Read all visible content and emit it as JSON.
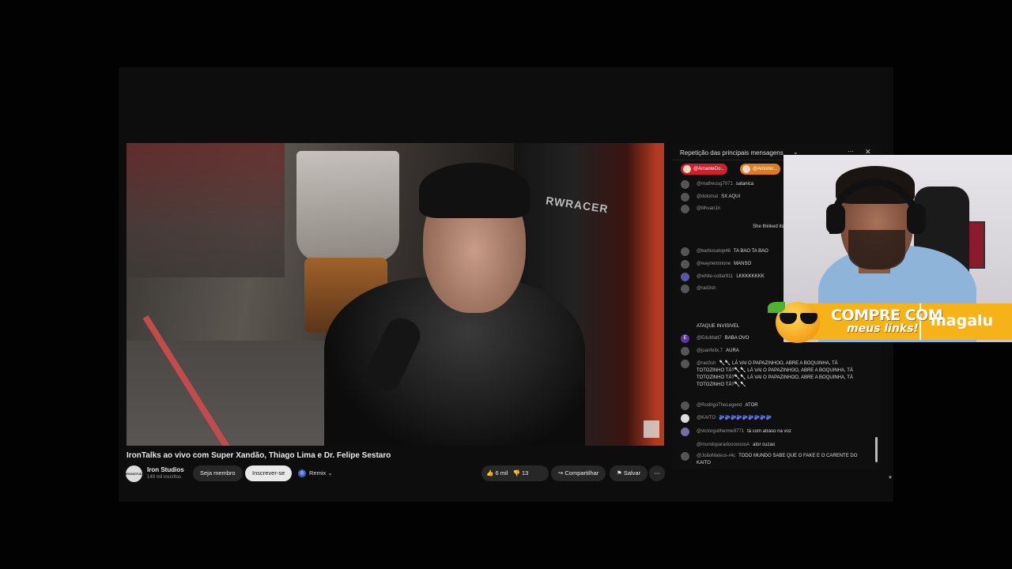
{
  "video": {
    "title": "IronTalks ao vivo com Super Xandão, Thiago Lima e Dr. Felipe Sestaro",
    "chair_brand": "RWRACER"
  },
  "channel": {
    "avatar_text": "IRONSTUDIOS",
    "name": "Iron Studios",
    "subscribers": "149 mil inscritos",
    "join_label": "Seja membro",
    "subscribe_label": "Inscrever-se",
    "remix_label": "Remix"
  },
  "actions": {
    "likes": "6 mil",
    "dislikes": "13",
    "share_label": "Compartilhar",
    "save_label": "Salvar"
  },
  "chat": {
    "header_title": "Repetição das principais mensagens",
    "chips": [
      "@AmanteDo...",
      "@Antonio..."
    ],
    "messages": [
      {
        "name": "@matheusg7071",
        "text": "satanica"
      },
      {
        "name": "@dolomal",
        "text": "SX AQUI"
      },
      {
        "name": "@lilhuan1n",
        "text": ""
      },
      {
        "name": "",
        "text": "She thinked its you???"
      },
      {
        "name": "@barbosatop46",
        "text": "TA BAO TA BAO"
      },
      {
        "name": "@waynemirione",
        "text": "MANSO"
      },
      {
        "name": "@white-cotlar911",
        "text": "LKKKKKKKK"
      },
      {
        "name": "@rad3sh",
        "text": ""
      },
      {
        "name": "",
        "text": "ATAQUE INVISIVEL"
      },
      {
        "name": "@EduMatt7",
        "text": "BABA OVO"
      },
      {
        "name": "@juanfelix.7",
        "text": "AURA"
      },
      {
        "name": "@rad3sh",
        "text": "🥄🥄 LÁ VAI O PAPAZINHOO, ABRE A BOQUINHA, TÁ TOTOZINHO TÁ?🥄🥄 LÁ VAI O PAPAZINHOO, ABRE A BOQUINHA, TÁ TOTOZINHO TÁ?🥄🥄 LÁ VAI O PAPAZINHOO, ABRE A BOQUINHA, TÁ TOTOZINHO TÁ?🥄🥄"
      },
      {
        "name": "@RodrigoTheLegend",
        "text": "ATOR"
      },
      {
        "name": "@KAITO",
        "text": "🫐🫐🫐🫐🫐🫐🫐🫐🫐"
      },
      {
        "name": "@victorguilherme9771",
        "text": "tá com atraso na voz"
      },
      {
        "name": "@mundoparadoooooooA",
        "text": "ator cuzao"
      },
      {
        "name": "@JoãoMateus-r4c",
        "text": "TODO MUNDO SABE QUE O FAKE E O CARENTE DO KAITO"
      }
    ]
  },
  "banner": {
    "line1": "COMPRE COM",
    "line2": "meus links!",
    "brand": "magalu"
  },
  "colors": {
    "subscribe_bg": "#e9e9e9",
    "chip1": "#d01f2e",
    "chip2": "#e07b1c",
    "banner": "#f5b319"
  }
}
